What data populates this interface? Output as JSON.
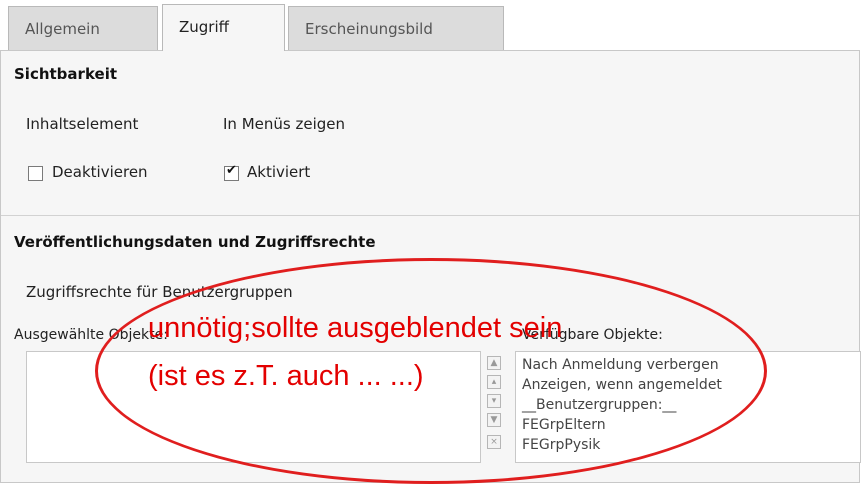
{
  "tabs": [
    {
      "label": "Allgemein"
    },
    {
      "label": "Zugriff"
    },
    {
      "label": "Erscheinungsbild"
    }
  ],
  "sichtbarkeit": {
    "title": "Sichtbarkeit",
    "col1_label": "Inhaltselement",
    "col2_label": "In Menüs zeigen",
    "checkbox1": {
      "label": "Deaktivieren",
      "checked": false
    },
    "checkbox2": {
      "label": "Aktiviert",
      "checked": true
    }
  },
  "zugriff": {
    "title": "Veröffentlichungsdaten und Zugriffsrechte",
    "subtitle": "Zugriffsrechte für Benutzergruppen",
    "selected_label": "Ausgewählte Objekte:",
    "available_label": "Verfügbare Objekte:",
    "available_items": [
      "Nach Anmeldung verbergen",
      "Anzeigen, wenn angemeldet",
      "__Benutzergruppen:__",
      "FEGrpEltern",
      "FEGrpPysik"
    ]
  },
  "annotation": {
    "line1": "unnötig;sollte ausgeblendet sein",
    "line2": "(ist es z.T. auch ... ...)",
    "color": "#e30000"
  }
}
